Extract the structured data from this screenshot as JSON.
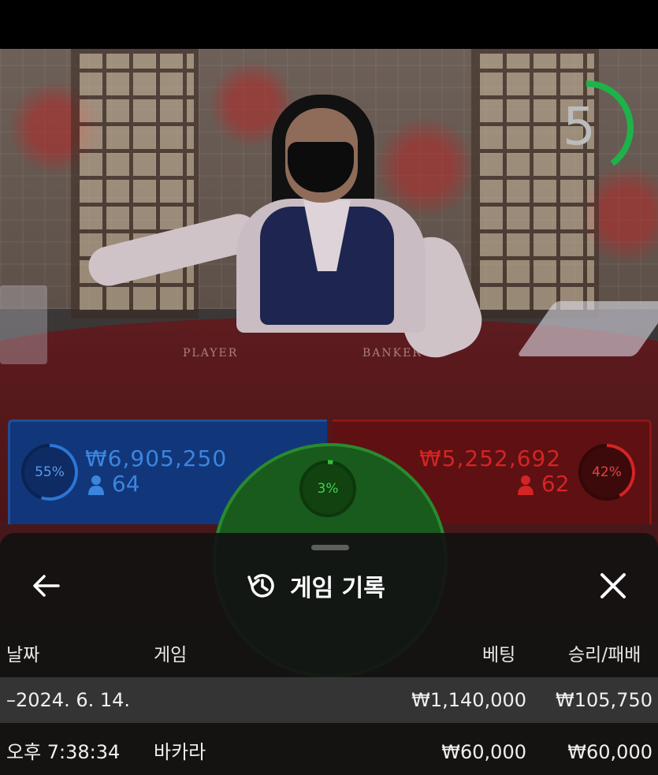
{
  "timer": {
    "value": "5",
    "progress": 0.4,
    "color": "#1db34a"
  },
  "table_felt": {
    "player_label": "PLAYER",
    "banker_label": "BANKER"
  },
  "player_bet": {
    "percent": "55%",
    "percent_value": 0.55,
    "amount": "₩6,905,250",
    "count": "64",
    "color": "#2b77d6"
  },
  "banker_bet": {
    "percent": "42%",
    "percent_value": 0.42,
    "amount": "₩5,252,692",
    "count": "62",
    "color": "#d42424"
  },
  "tie_bet": {
    "percent": "3%",
    "percent_value": 0.03,
    "color": "#2fc240"
  },
  "sheet": {
    "title": "게임 기록",
    "back_icon": "arrow-left-icon",
    "history_icon": "history-icon",
    "close_icon": "close-icon",
    "columns": {
      "date": "날짜",
      "game": "게임",
      "bet": "베팅",
      "result": "승리/패배"
    },
    "summary_row": {
      "date": "–2024. 6. 14.",
      "bet": "₩1,140,000",
      "result": "₩105,750"
    },
    "rows": [
      {
        "time": "오후 7:38:34",
        "game": "바카라",
        "bet": "₩60,000",
        "result": "₩60,000"
      }
    ]
  }
}
